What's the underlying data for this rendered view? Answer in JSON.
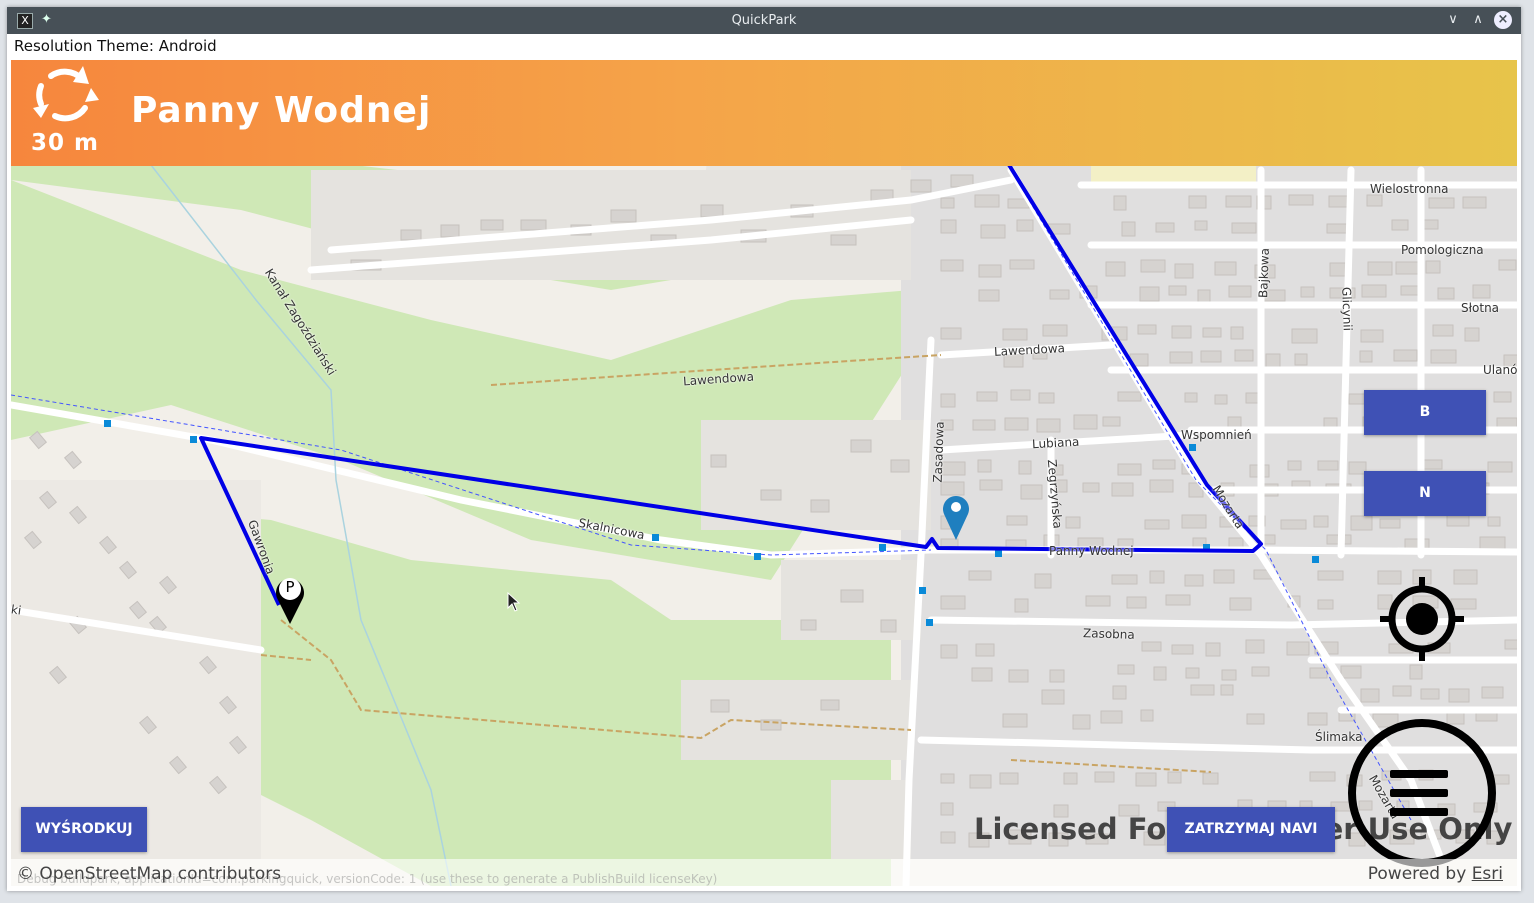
{
  "window": {
    "title": "QuickPark",
    "controls": [
      "minimize",
      "maximize",
      "close"
    ]
  },
  "resolution_theme": "Resolution Theme: Android",
  "navigation": {
    "turn_icon": "roundabout-icon",
    "distance": "30 m",
    "street": "Panny Wodnej",
    "banner_colors": [
      "#f6863d",
      "#e7c44a"
    ]
  },
  "buttons": {
    "b": "B",
    "n": "N",
    "center": "WYŚRODKUJ",
    "stop_navi": "ZATRZYMAJ NAVI"
  },
  "watermark": "Licensed For Developer Use Only",
  "attribution": {
    "left": "© OpenStreetMap contributors",
    "right_prefix": "Powered by ",
    "right_link": "Esri"
  },
  "debug_text": "Debug buildpark, applicationId=com.parkingquick, versionCode: 1 (use these to generate a PublishBuild licenseKey)",
  "map_labels": {
    "kanal": "Kanał Zagoździański",
    "lawendowa_west": "Lawendowa",
    "lawendowa_east": "Lawendowa",
    "skalnicowa": "Skalnicowa",
    "gawronia": "Gawronia",
    "zasadowa": "Zasadowa",
    "lubiana": "Lubiana",
    "zegrzynska": "Zegrzyńska",
    "panny_wodnej": "Panny Wodnej",
    "wspomnien": "Wspomnień",
    "mozarta": "Mozarta",
    "wielostronna": "Wielostronna",
    "pomologiczna": "Pomologiczna",
    "slotna": "Słotna",
    "ulanow": "Ulanó",
    "bajkowa": "Bajkowa",
    "glicynii": "Glicynii",
    "zasobna": "Zasobna",
    "slimaka": "Ślimaka",
    "mozarta_s": "Mozarta",
    "ki": "ki",
    "parking_marker": "P"
  },
  "colors": {
    "route": "#0000e6",
    "button": "#3f51b5",
    "park": "#cfe8b6",
    "residential": "#e0dfdf",
    "destination_pin": "#1f7fbf"
  }
}
